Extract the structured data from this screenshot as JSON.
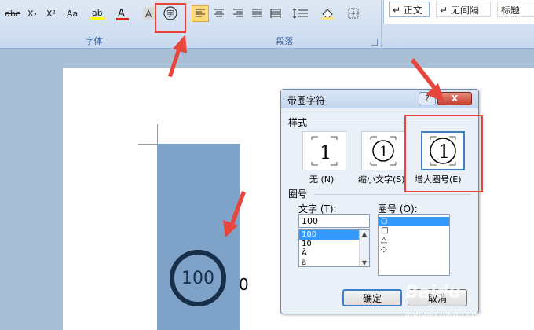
{
  "ribbon": {
    "font_group_label": "字体",
    "paragraph_group_label": "段落",
    "font_buttons": [
      "abc",
      "X₂",
      "X²",
      "Aa"
    ],
    "style_items": [
      "↵ 正文",
      "↵ 无间隔",
      "标题"
    ]
  },
  "document": {
    "enclosed_text": "100",
    "trailing_text": "0"
  },
  "dialog": {
    "title": "带圈字符",
    "help_label": "?",
    "close_label": "X",
    "style_section": "样式",
    "style_options": [
      {
        "glyph": "1",
        "label": "无 (N)"
      },
      {
        "glyph": "①",
        "label": "缩小文字(S)"
      },
      {
        "glyph": "①",
        "label": "增大圈号(E)"
      }
    ],
    "ring_section": "圈号",
    "text_label": "文字 (T):",
    "ring_label": "圈号 (O):",
    "text_value": "100",
    "text_list": [
      "100",
      "10",
      "Ā",
      "ā"
    ],
    "ring_list": [
      "○",
      "□",
      "△",
      "◇"
    ],
    "ok_label": "确定",
    "cancel_label": "取消"
  },
  "watermark": {
    "brand": "Baidu",
    "url": "jingyan.baidu.com"
  },
  "colors": {
    "accent_red": "#e8453c",
    "selection_blue": "#7fa2c8",
    "ring_dark": "#182f4a"
  }
}
